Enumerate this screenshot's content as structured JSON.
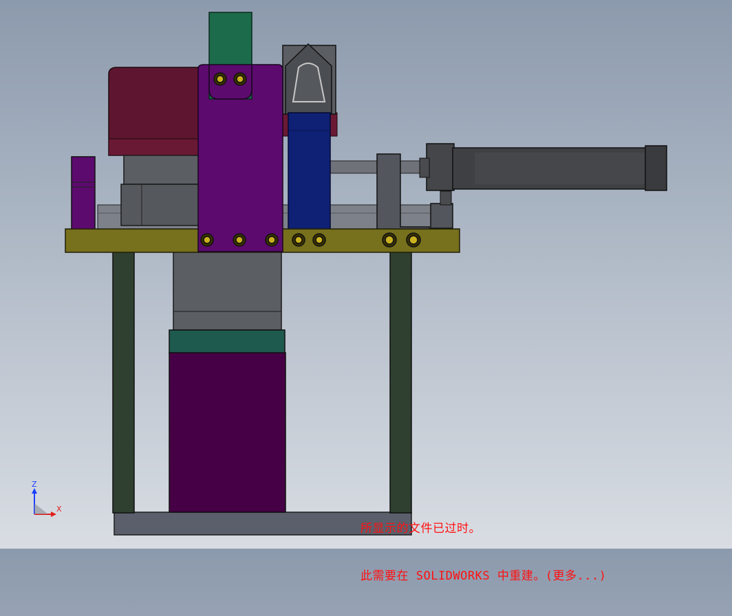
{
  "viewport": {
    "background_top": "#8c9aad",
    "background_bottom": "#d9dde3"
  },
  "triad": {
    "z_label": "Z",
    "x_label": "X",
    "z_color": "#1a3cff",
    "x_color": "#e0201c"
  },
  "notice": {
    "line1": "所显示的文件已过时。",
    "line2": "此需要在 SOLIDWORKS 中重建。(更多...)",
    "color": "#ff1010"
  },
  "model": {
    "part_colors": {
      "base_plate": "#77701c",
      "legs": "#2f4030",
      "bottom_frame": "#5a5f6b",
      "purple_plate": "#5c0a6e",
      "lower_housing": "#460045",
      "teal_collar": "#1f5a4f",
      "green_tab": "#1c6b4b",
      "red_block": "#5e1530",
      "blue_bar": "#0f2175",
      "gray_body": "#5b5e63",
      "cylinder": "#3f4043"
    }
  }
}
